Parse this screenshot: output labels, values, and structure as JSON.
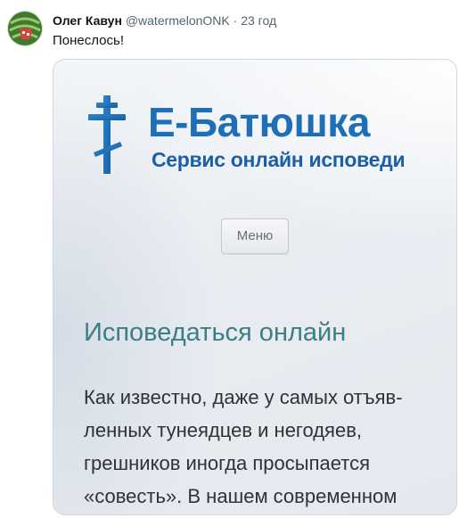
{
  "tweet": {
    "author_name": "Олег Кавун",
    "handle": "@watermelonONK",
    "separator": "·",
    "time": "23 год",
    "text": "Понеслось!"
  },
  "screenshot": {
    "logo_title": "Е-Батюшка",
    "logo_subtitle": "Сервис онлайн исповеди",
    "menu_label": "Меню",
    "heading": "Исповедаться онлайн",
    "body_lines": [
      "Как известно, даже у самых отъяв-",
      "ленных тунеядцев и негодяев,",
      "грешников иногда просыпается",
      "«совесть». В нашем современном"
    ]
  },
  "colors": {
    "brand_blue": "#1f6fb6",
    "heading_teal": "#3d7e86",
    "card_border": "#cfd9de"
  },
  "icons": {
    "avatar": "watermelon-avatar",
    "logo_mark": "orthodox-cross-icon"
  }
}
